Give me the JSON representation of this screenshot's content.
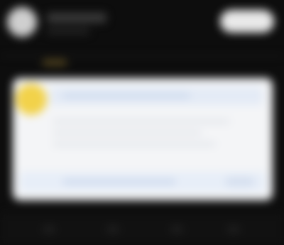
{
  "theme": {
    "background": "#0d0d0d",
    "card_background": "#f4f5f7",
    "accent": "#f2d24a"
  },
  "header": {
    "avatar_icon": "avatar-icon",
    "action_icon": "pill-button"
  },
  "card": {
    "badge_icon": "badge-icon"
  },
  "bottom_nav": {
    "icons": [
      "nav-icon",
      "nav-icon",
      "nav-icon",
      "nav-icon"
    ]
  }
}
